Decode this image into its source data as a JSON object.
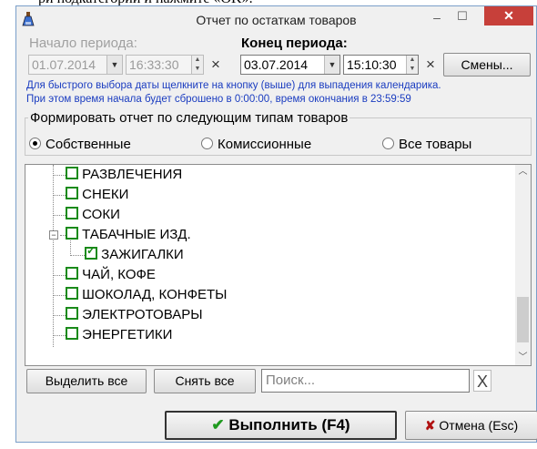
{
  "doc_strip_text": "ри подкатегории и нажмите «OK».",
  "window": {
    "title": "Отчет по остаткам товаров",
    "minimize_glyph": "–",
    "maximize_glyph": "☐",
    "close_glyph": "✕"
  },
  "period": {
    "start_label": "Начало периода:",
    "start_date": "01.07.2014",
    "start_time": "16:33:30",
    "end_label": "Конец периода:",
    "end_date": "03.07.2014",
    "end_time": "15:10:30",
    "clear_glyph": "×",
    "shifts_button": "Смены..."
  },
  "hint_lines": [
    "Для быстрого выбора даты щелкните на кнопку (выше) для выпадения календарика.",
    "При этом время начала будет сброшено в 0:00:00, время окончания в 23:59:59"
  ],
  "product_types": {
    "group_title": "Формировать отчет по следующим типам товаров",
    "options": [
      "Собственные",
      "Комиссионные",
      "Все товары"
    ],
    "selected": "Собственные"
  },
  "tree_nodes": [
    {
      "label": "РАЗВЛЕЧЕНИЯ",
      "checked": false
    },
    {
      "label": "СНЕКИ",
      "checked": false
    },
    {
      "label": "СОКИ",
      "checked": false
    },
    {
      "label": "ТАБАЧНЫЕ ИЗД.",
      "checked": false,
      "expanded": true
    },
    {
      "label": "ЗАЖИГАЛКИ",
      "checked": true
    },
    {
      "label": "ЧАЙ, КОФЕ",
      "checked": false
    },
    {
      "label": "ШОКОЛАД, КОНФЕТЫ",
      "checked": false
    },
    {
      "label": "ЭЛЕКТРОТОВАРЫ",
      "checked": false
    },
    {
      "label": "ЭНЕРГЕТИКИ",
      "checked": false
    }
  ],
  "bottom_bar": {
    "select_all": "Выделить все",
    "deselect_all": "Снять все",
    "search_placeholder": "Поиск...",
    "clear_glyph": "X"
  },
  "actions": {
    "run_label": "Выполнить (F4)",
    "cancel_label": "Отмена (Esc)"
  },
  "colors": {
    "hint_text": "#1a3cc0",
    "checkbox_green": "#1a8a1a",
    "close_button": "#c7403a",
    "cancel_x": "#b01010"
  }
}
